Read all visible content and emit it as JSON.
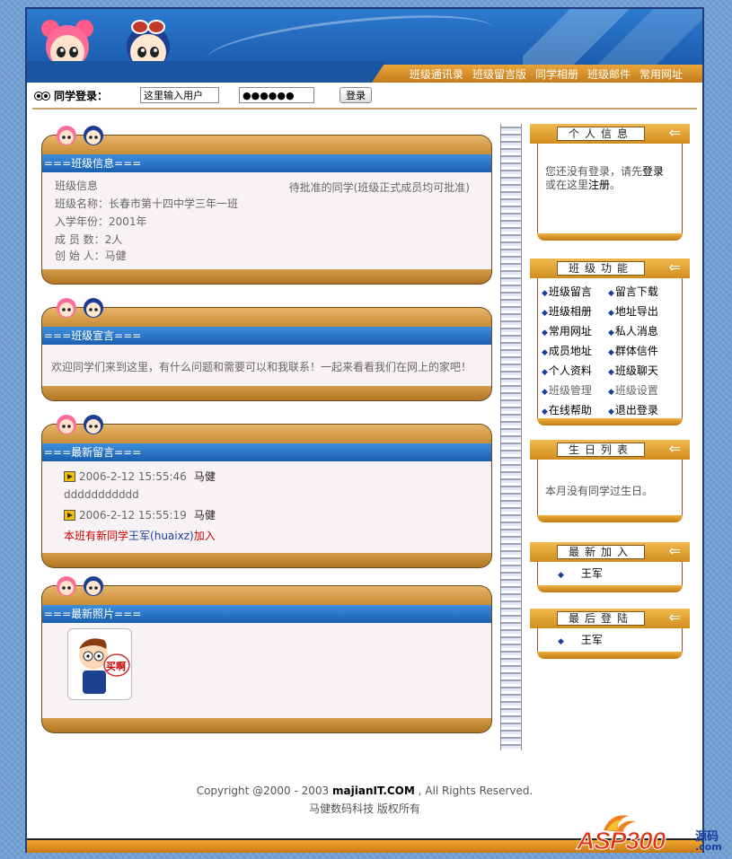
{
  "nav": {
    "links": [
      "班级通讯录",
      "班级留言版",
      "同学相册",
      "班级邮件",
      "常用网址"
    ]
  },
  "login": {
    "label": "同学登录：",
    "user_value": "这里输入用户",
    "password_value": "●●●●●●",
    "button": "登录"
  },
  "class_info": {
    "title": "===班级信息===",
    "heading": "班级信息",
    "pending": "待批准的同学(班级正式成员均可批准)",
    "name": "班级名称：长春市第十四中学三年一班",
    "year": "入学年份：2001年",
    "members": "成 员 数：2人",
    "founder": "创 始 人：马健"
  },
  "announcement": {
    "title": "===班级宣言===",
    "text": "欢迎同学们来到这里，有什么问题和需要可以和我联系！一起来看看我们在网上的家吧！"
  },
  "messages": {
    "title": "===最新留言===",
    "items": [
      {
        "time": "2006-2-12 15:55:46",
        "author": "马健",
        "content": "ddddddddddd"
      },
      {
        "time": "2006-2-12 15:55:19",
        "author": "马健",
        "content": ""
      }
    ],
    "newmember_prefix": "本班有新同学",
    "newmember_name": "王军",
    "newmember_id": "(huaixz)",
    "newmember_suffix": "加入"
  },
  "photos": {
    "title": "===最新照片===",
    "photo_text": "买啊"
  },
  "personal": {
    "title": "个人信息",
    "text1": "您还没有登录，请先",
    "link1": "登录",
    "text2": "或在这里",
    "link2": "注册",
    "text3": "。"
  },
  "functions": {
    "title": "班级功能",
    "items": [
      "班级留言",
      "留言下载",
      "班级相册",
      "地址导出",
      "常用网址",
      "私人消息",
      "成员地址",
      "群体信件",
      "个人资料",
      "班级聊天",
      "班级管理",
      "班级设置",
      "在线帮助",
      "退出登录"
    ]
  },
  "birthday": {
    "title": "生日列表",
    "text": "本月没有同学过生日。"
  },
  "newest": {
    "title": "最新加入",
    "name": "王军"
  },
  "lastlogin": {
    "title": "最后登陆",
    "name": "王军"
  },
  "footer": {
    "copyright_prefix": "Copyright @2000 - 2003 ",
    "brand": "majianIT.COM",
    "copyright_suffix": " , All Rights Reserved.",
    "line2": "马健数码科技 版权所有"
  },
  "watermark": {
    "brand": "ASP300",
    "cn": "源码",
    "dom": ".com"
  },
  "colors": {
    "accent": "#1a5fae",
    "orange": "#d08d1e",
    "red": "#cc0000"
  }
}
